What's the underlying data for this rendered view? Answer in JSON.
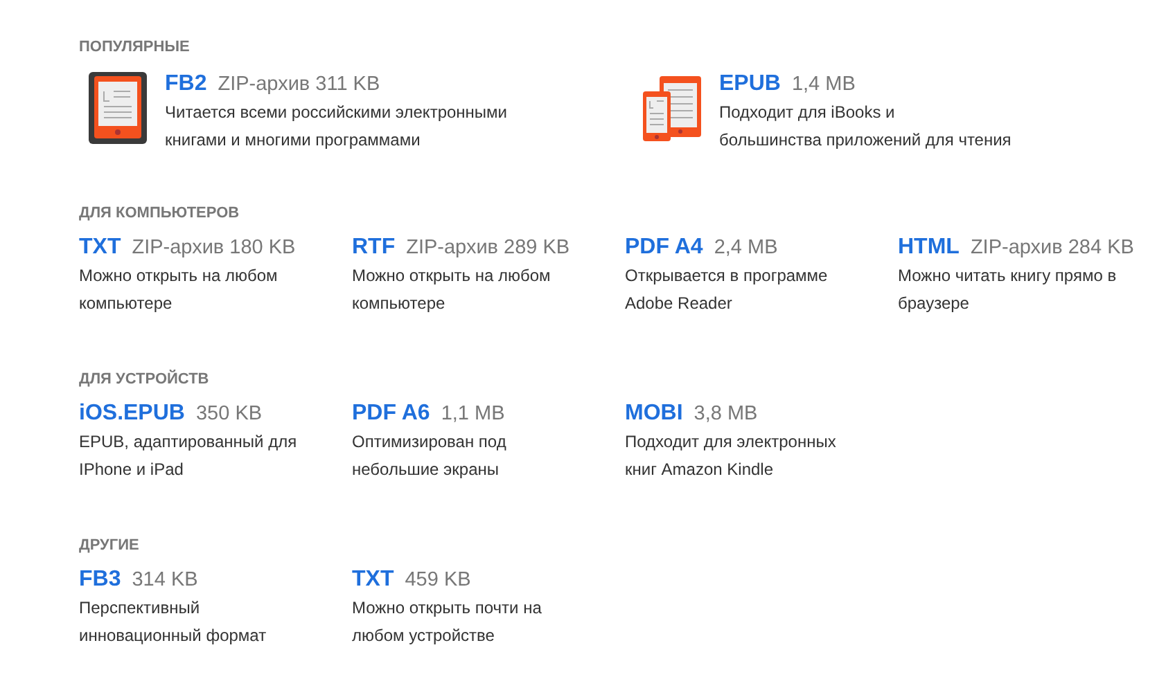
{
  "sections": [
    {
      "heading": "ПОПУЛЯРНЫЕ",
      "featured": true,
      "formats": [
        {
          "kind": "ereader",
          "name": "FB2",
          "size": "ZIP-архив 311 KB",
          "description": "Читается всеми российскими электронными книгами и многими программами"
        },
        {
          "kind": "devices",
          "name": "EPUB",
          "size": "1,4 MB",
          "description": "Подходит для iBooks и\nбольшинства приложений для чтения"
        }
      ]
    },
    {
      "heading": "ДЛЯ КОМПЬЮТЕРОВ",
      "featured": false,
      "formats": [
        {
          "name": "TXT",
          "size": "ZIP-архив 180 KB",
          "description": "Можно открыть на любом компьютере"
        },
        {
          "name": "RTF",
          "size": "ZIP-архив 289 KB",
          "description": "Можно открыть на любом компьютере"
        },
        {
          "name": "PDF A4",
          "size": "2,4 MB",
          "description": "Открывается в программе Adobe Reader"
        },
        {
          "name": "HTML",
          "size": "ZIP-архив 284 KB",
          "description": "Можно читать книгу прямо в браузере"
        }
      ]
    },
    {
      "heading": "ДЛЯ УСТРОЙСТВ",
      "featured": false,
      "formats": [
        {
          "name": "iOS.EPUB",
          "size": "350 KB",
          "description": "EPUB, адаптированный для IPhone и iPad"
        },
        {
          "name": "PDF A6",
          "size": "1,1 MB",
          "description": "Оптимизирован под небольшие экраны"
        },
        {
          "name": "MOBI",
          "size": "3,8 MB",
          "description": "Подходит для электронных книг Amazon Kindle"
        }
      ]
    },
    {
      "heading": "ДРУГИЕ",
      "featured": false,
      "formats": [
        {
          "name": "FB3",
          "size": "314 KB",
          "description": "Перспективный инновационный формат"
        },
        {
          "name": "TXT",
          "size": "459 KB",
          "description": "Можно открыть почти на любом устройстве"
        }
      ]
    }
  ]
}
